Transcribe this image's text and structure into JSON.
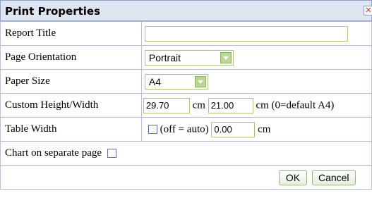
{
  "dialog": {
    "title": "Print Properties",
    "close_icon": "close-icon",
    "close_glyph": "✕"
  },
  "fields": {
    "report_title": {
      "label": "Report Title",
      "value": ""
    },
    "orientation": {
      "label": "Page Orientation",
      "value": "Portrait"
    },
    "paper_size": {
      "label": "Paper Size",
      "value": "A4"
    },
    "custom_size": {
      "label": "Custom Height/Width",
      "height": "29.70",
      "unit1": "cm",
      "width": "21.00",
      "unit2": "cm (0=default A4)"
    },
    "table_width": {
      "label": "Table Width",
      "checkbox_label": "(off = auto)",
      "value": "0.00",
      "unit": "cm"
    },
    "chart_separate": {
      "label": "Chart on separate page"
    }
  },
  "buttons": {
    "ok": "OK",
    "cancel": "Cancel"
  },
  "colors": {
    "titlebar": "#dfe6f2",
    "input_border": "#a8c87e",
    "dropdown_arrow": "#b8d890",
    "close_x": "#d04020"
  }
}
